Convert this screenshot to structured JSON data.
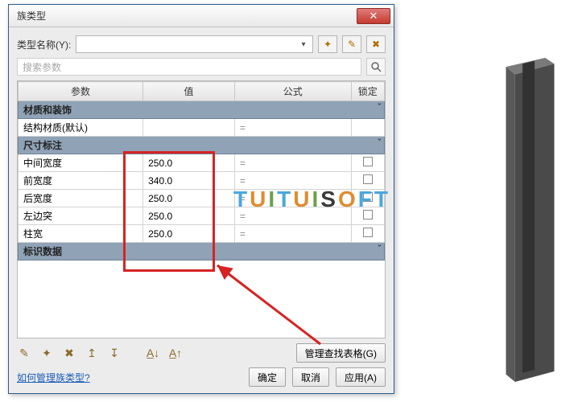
{
  "dialog": {
    "title": "族类型",
    "close_name": "close-icon",
    "type_name_label": "类型名称(Y):",
    "new_type_icon": "new-type-icon",
    "rename_type_icon": "rename-type-icon",
    "delete_type_icon": "delete-type-icon",
    "search_placeholder": "搜索参数",
    "search_icon": "search-icon",
    "columns": {
      "param": "参数",
      "value": "值",
      "formula": "公式",
      "lock": "锁定"
    },
    "groups": [
      {
        "title": "材质和装饰",
        "rows": [
          {
            "param": "结构材质(默认)",
            "value": "",
            "has_lock": false
          }
        ]
      },
      {
        "title": "尺寸标注",
        "rows": [
          {
            "param": "中间宽度",
            "value": "250.0",
            "has_lock": true
          },
          {
            "param": "前宽度",
            "value": "340.0",
            "has_lock": true
          },
          {
            "param": "后宽度",
            "value": "250.0",
            "has_lock": true
          },
          {
            "param": "左边突",
            "value": "250.0",
            "has_lock": true
          },
          {
            "param": "柱宽",
            "value": "250.0",
            "has_lock": true
          }
        ]
      },
      {
        "title": "标识数据",
        "rows": []
      }
    ],
    "toolbar_icons": [
      "edit-icon",
      "new-param-icon",
      "delete-param-icon",
      "move-up-icon",
      "move-down-icon",
      "sort-asc-icon",
      "sort-desc-icon"
    ],
    "manage_lookup": "管理查找表格(G)",
    "help_link": "如何管理族类型?",
    "ok": "确定",
    "cancel": "取消",
    "apply": "应用(A)"
  },
  "brand_letters": [
    "T",
    "U",
    "I",
    "T",
    "U",
    "I",
    "S",
    "O",
    "F",
    "T"
  ],
  "brand_classes": [
    "t",
    "u",
    "i",
    "t",
    "u",
    "i",
    "s",
    "o",
    "f",
    "t"
  ]
}
